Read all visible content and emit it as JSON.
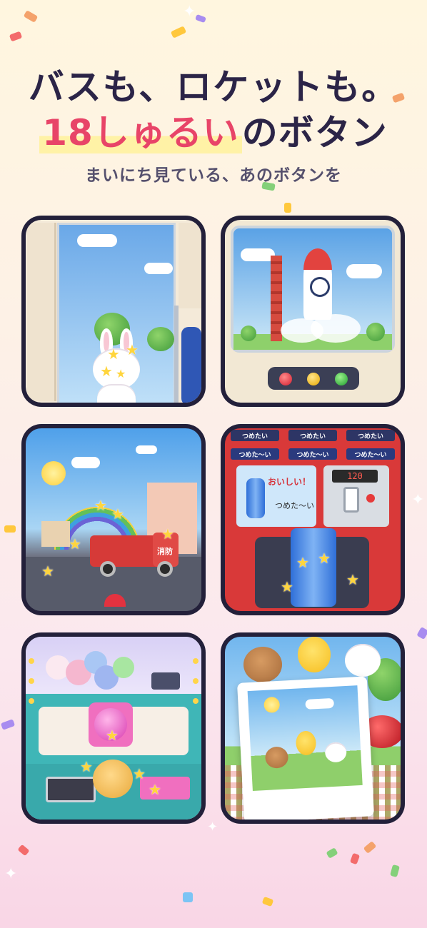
{
  "headline": {
    "line1": "バスも、ロケットも。",
    "line2_highlight": "18しゅるい",
    "line2_rest": "のボタン",
    "subtitle": "まいにち見ている、あのボタンを"
  },
  "tiles": [
    {
      "name": "bus-scene"
    },
    {
      "name": "rocket-scene"
    },
    {
      "name": "fire-truck-scene",
      "truck_text": "消防"
    },
    {
      "name": "vending-machine-scene",
      "top_chips": [
        "つめたい",
        "つめたい",
        "つめたい"
      ],
      "chips": [
        "つめた〜い",
        "つめた〜い",
        "つめた〜い"
      ],
      "label": "おいしい！",
      "can_label": "つめた〜い",
      "display": "120"
    },
    {
      "name": "claw-machine-scene"
    },
    {
      "name": "photo-scene"
    }
  ],
  "colors": {
    "accent": "#e84468",
    "text": "#2b2447",
    "frame": "#23203a"
  }
}
